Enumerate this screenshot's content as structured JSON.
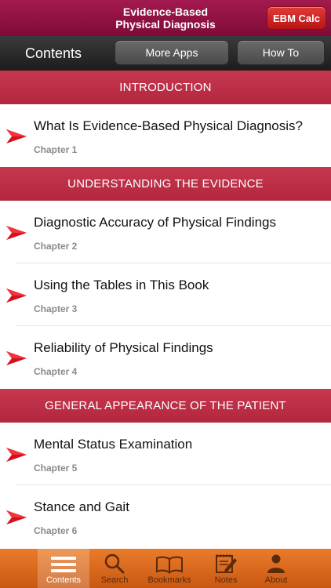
{
  "header": {
    "title_line1": "Evidence-Based",
    "title_line2": "Physical Diagnosis",
    "ebm_button": "EBM Calc"
  },
  "nav": {
    "title": "Contents",
    "more_apps": "More Apps",
    "how_to": "How To"
  },
  "sections": [
    {
      "heading": "INTRODUCTION",
      "chapters": [
        {
          "title": "What Is Evidence-Based Physical Diagnosis?",
          "sub": "Chapter 1"
        }
      ]
    },
    {
      "heading": "UNDERSTANDING THE EVIDENCE",
      "chapters": [
        {
          "title": "Diagnostic Accuracy of Physical Findings",
          "sub": "Chapter 2"
        },
        {
          "title": "Using the Tables in This Book",
          "sub": "Chapter 3"
        },
        {
          "title": "Reliability of Physical Findings",
          "sub": "Chapter 4"
        }
      ]
    },
    {
      "heading": "GENERAL APPEARANCE OF THE PATIENT",
      "chapters": [
        {
          "title": "Mental Status Examination",
          "sub": "Chapter 5"
        },
        {
          "title": "Stance and Gait",
          "sub": "Chapter 6"
        }
      ]
    }
  ],
  "tabs": [
    {
      "label": "Contents",
      "icon": "list-icon",
      "active": true
    },
    {
      "label": "Search",
      "icon": "search-icon",
      "active": false
    },
    {
      "label": "Bookmarks",
      "icon": "book-icon",
      "active": false
    },
    {
      "label": "Notes",
      "icon": "notes-icon",
      "active": false
    },
    {
      "label": "About",
      "icon": "person-icon",
      "active": false
    }
  ],
  "colors": {
    "title_bar": "#8f1242",
    "section_header": "#bb2e46",
    "arrow_red": "#d4101e",
    "tab_bar": "#dc6a1e"
  }
}
